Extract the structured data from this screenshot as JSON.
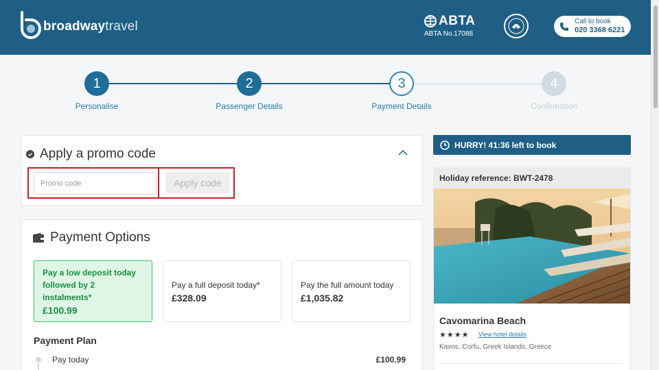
{
  "header": {
    "brand_bold": "broadway",
    "brand_light": "travel",
    "abta_title": "ABTA",
    "abta_number": "ABTA No.17088",
    "call_label": "Call to book",
    "call_number": "020 3368 6221"
  },
  "steps": [
    {
      "number": "1",
      "label": "Personalise",
      "state": "done"
    },
    {
      "number": "2",
      "label": "Passenger Details",
      "state": "done"
    },
    {
      "number": "3",
      "label": "Payment Details",
      "state": "current"
    },
    {
      "number": "4",
      "label": "Confirmation",
      "state": "todo"
    }
  ],
  "promo": {
    "title": "Apply a promo code",
    "input_placeholder": "Promo code",
    "apply_label": "Apply code"
  },
  "payment": {
    "title": "Payment Options",
    "options": [
      {
        "label": "Pay a low deposit today followed by 2 instalments*",
        "price": "£100.99",
        "selected": true
      },
      {
        "label": "Pay a full deposit today*",
        "price": "£328.09",
        "selected": false
      },
      {
        "label": "Pay the full amount today",
        "price": "£1,035.82",
        "selected": false
      }
    ],
    "plan_title": "Payment Plan",
    "plan_rows": [
      {
        "label": "Pay today",
        "value": "£100.99"
      }
    ]
  },
  "sidebar": {
    "hurry_text": "HURRY! 41:36 left to book",
    "holiday_ref": "Holiday reference: BWT-2478",
    "hotel_name": "Cavomarina Beach",
    "stars": "★★★★",
    "view_link": "View hotel details",
    "location": "Kavos, Corfu, Greek Islands, Greece"
  },
  "colors": {
    "brand": "#1f5f86",
    "accent": "#2a82b5",
    "selected_green": "#17903e",
    "highlight_red": "#d11a2a"
  }
}
